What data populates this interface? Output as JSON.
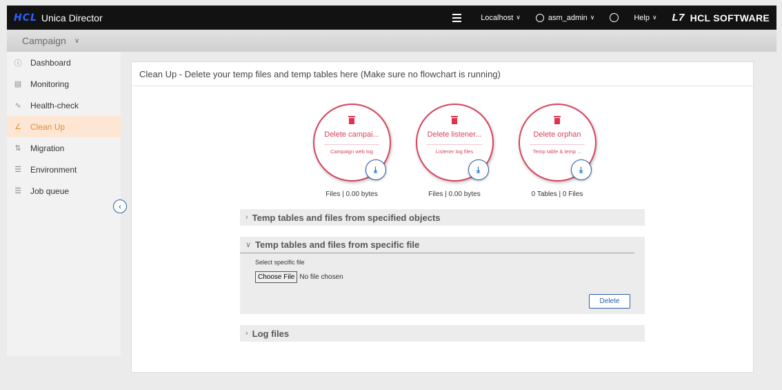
{
  "header": {
    "brand_logo": "HCL",
    "app_name": "Unica Director",
    "server": "Localhost",
    "user": "asm_admin",
    "help": "Help",
    "vendor": "HCL SOFTWARE",
    "vendor_mark": "L7"
  },
  "module": {
    "selected": "Campaign"
  },
  "sidebar": {
    "items": [
      {
        "label": "Dashboard",
        "icon": "info-icon"
      },
      {
        "label": "Monitoring",
        "icon": "monitor-icon"
      },
      {
        "label": "Health-check",
        "icon": "heartbeat-icon"
      },
      {
        "label": "Clean Up",
        "icon": "broom-icon",
        "active": true
      },
      {
        "label": "Migration",
        "icon": "migration-icon"
      },
      {
        "label": "Environment",
        "icon": "sliders-icon"
      },
      {
        "label": "Job queue",
        "icon": "list-icon"
      }
    ]
  },
  "page": {
    "title": "Clean Up - Delete your temp files and temp tables here (Make sure no flowchart is running)"
  },
  "cards": [
    {
      "title": "Delete campai...",
      "subtitle": "Campaign web log",
      "info": "Files | 0.00 bytes"
    },
    {
      "title": "Delete listener...",
      "subtitle": "Listener log files",
      "info": "Files | 0.00 bytes"
    },
    {
      "title": "Delete orphan",
      "subtitle": "Temp table & temp ...",
      "info": "0 Tables | 0 Files"
    }
  ],
  "accordions": {
    "specified_objects": "Temp tables and files from specified objects",
    "specific_file": {
      "title": "Temp tables and files from specific file",
      "label": "Select specific file",
      "choose_button": "Choose File",
      "no_file": "No file chosen",
      "delete_button": "Delete"
    },
    "log_files": "Log files"
  },
  "colors": {
    "accent_red": "#d7435c",
    "accent_blue": "#2a5ea8",
    "active_orange": "#e8892e"
  }
}
